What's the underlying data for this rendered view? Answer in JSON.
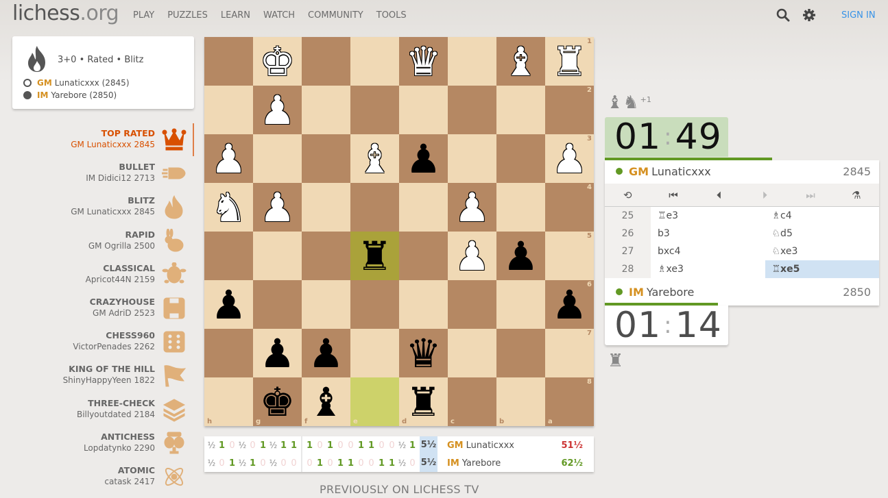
{
  "header": {
    "logo_main": "lichess",
    "logo_tld": ".org",
    "nav": [
      "PLAY",
      "PUZZLES",
      "LEARN",
      "WATCH",
      "COMMUNITY",
      "TOOLS"
    ],
    "search_icon": "search-icon",
    "settings_icon": "gear-icon",
    "signin_label": "SIGN IN"
  },
  "game_card": {
    "icon": "fire-icon",
    "description": "3+0 • Rated • Blitz",
    "players": [
      {
        "color": "white",
        "title": "GM",
        "name": "Lunaticxxx (2845)"
      },
      {
        "color": "black",
        "title": "IM",
        "name": "Yarebore (2850)"
      }
    ]
  },
  "leaderboards": [
    {
      "name": "TOP RATED",
      "leader": "GM Lunaticxxx 2845",
      "icon": "crown-icon",
      "active": true
    },
    {
      "name": "BULLET",
      "leader": "IM Didici12 2713",
      "icon": "bullet-icon"
    },
    {
      "name": "BLITZ",
      "leader": "GM Lunaticxxx 2845",
      "icon": "fire-icon"
    },
    {
      "name": "RAPID",
      "leader": "GM Ogrilla 2500",
      "icon": "rabbit-icon"
    },
    {
      "name": "CLASSICAL",
      "leader": "Apricot44N 2159",
      "icon": "turtle-icon"
    },
    {
      "name": "CRAZYHOUSE",
      "leader": "GM AdriD 2523",
      "icon": "crazyhouse-icon"
    },
    {
      "name": "CHESS960",
      "leader": "VictorPenades 2262",
      "icon": "dice-icon"
    },
    {
      "name": "KING OF THE HILL",
      "leader": "ShinyHappyYeen 1822",
      "icon": "flag-icon"
    },
    {
      "name": "THREE-CHECK",
      "leader": "Billyoutdated 2184",
      "icon": "layers-icon"
    },
    {
      "name": "ANTICHESS",
      "leader": "Lopdatynko 2290",
      "icon": "antichess-icon"
    },
    {
      "name": "ATOMIC",
      "leader": "catask 2417",
      "icon": "atom-icon"
    }
  ],
  "board": {
    "orientation": "black",
    "files": [
      "h",
      "g",
      "f",
      "e",
      "d",
      "c",
      "b",
      "a"
    ],
    "ranks": [
      "1",
      "2",
      "3",
      "4",
      "5",
      "6",
      "7",
      "8"
    ],
    "last_move": {
      "from": "e8",
      "to": "e5"
    },
    "pieces": {
      "g1": "wK",
      "d1": "wQ",
      "b1": "wB",
      "a1": "wR",
      "g2": "wP",
      "h3": "wP",
      "e3": "wB",
      "d3": "bP",
      "a3": "wP",
      "h4": "wN",
      "g4": "wP",
      "c4": "wP",
      "e5": "bR",
      "c5": "wP",
      "b5": "bP",
      "h6": "bP",
      "a6": "bP",
      "g7": "bP",
      "f7": "bP",
      "d7": "bQ",
      "g8": "bK",
      "f8": "bB",
      "d8": "bR"
    }
  },
  "crosstable": {
    "block1": {
      "top": [
        "½",
        "1",
        "0",
        "½",
        "0",
        "1",
        "½",
        "1",
        "1"
      ],
      "bottom": [
        "½",
        "0",
        "1",
        "½",
        "1",
        "0",
        "½",
        "0",
        "0"
      ]
    },
    "block2": {
      "top": [
        "1",
        "0",
        "1",
        "0",
        "0",
        "1",
        "1",
        "0",
        "0",
        "½",
        "1"
      ],
      "bottom": [
        "0",
        "1",
        "0",
        "1",
        "1",
        "0",
        "0",
        "1",
        "1",
        "½",
        "0"
      ]
    },
    "current_sum": [
      "5½",
      "5½"
    ],
    "players": [
      {
        "title": "GM",
        "name": "Lunaticxxx",
        "score": "51½"
      },
      {
        "title": "IM",
        "name": "Yarebore",
        "score": "62½"
      }
    ]
  },
  "tv_title": "PREVIOUSLY ON LICHESS TV",
  "right_panel": {
    "top_material": [
      "♝",
      "♞"
    ],
    "top_material_plus": "+1",
    "top_clock": {
      "min": "01",
      "sec": "49",
      "sep": ":",
      "time_fraction": 0.61
    },
    "top_user": {
      "title": "GM",
      "name": "Lunaticxxx",
      "rating": "2845"
    },
    "controls": [
      {
        "icon": "flip-board-icon",
        "glyph": "⟲",
        "enabled": true
      },
      {
        "icon": "first-move-icon",
        "glyph": "⏮",
        "enabled": true
      },
      {
        "icon": "prev-move-icon",
        "glyph": "⏴",
        "enabled": true
      },
      {
        "icon": "next-move-icon",
        "glyph": "⏵",
        "enabled": false
      },
      {
        "icon": "last-move-icon",
        "glyph": "⏭",
        "enabled": false
      },
      {
        "icon": "analysis-icon",
        "glyph": "⚗",
        "enabled": true
      }
    ],
    "moves": [
      {
        "n": "25",
        "white": "♖e3",
        "black": "♗c4"
      },
      {
        "n": "26",
        "white": "b3",
        "black": "♘d5"
      },
      {
        "n": "27",
        "white": "bxc4",
        "black": "♘xe3"
      },
      {
        "n": "28",
        "white": "♗xe3",
        "black": "♖xe5"
      }
    ],
    "current_move": "28b",
    "bottom_user": {
      "title": "IM",
      "name": "Yarebore",
      "rating": "2850"
    },
    "bottom_clock": {
      "min": "01",
      "sec": "14",
      "sep": ":",
      "time_fraction": 0.5
    },
    "bottom_material": [
      "♜"
    ]
  }
}
